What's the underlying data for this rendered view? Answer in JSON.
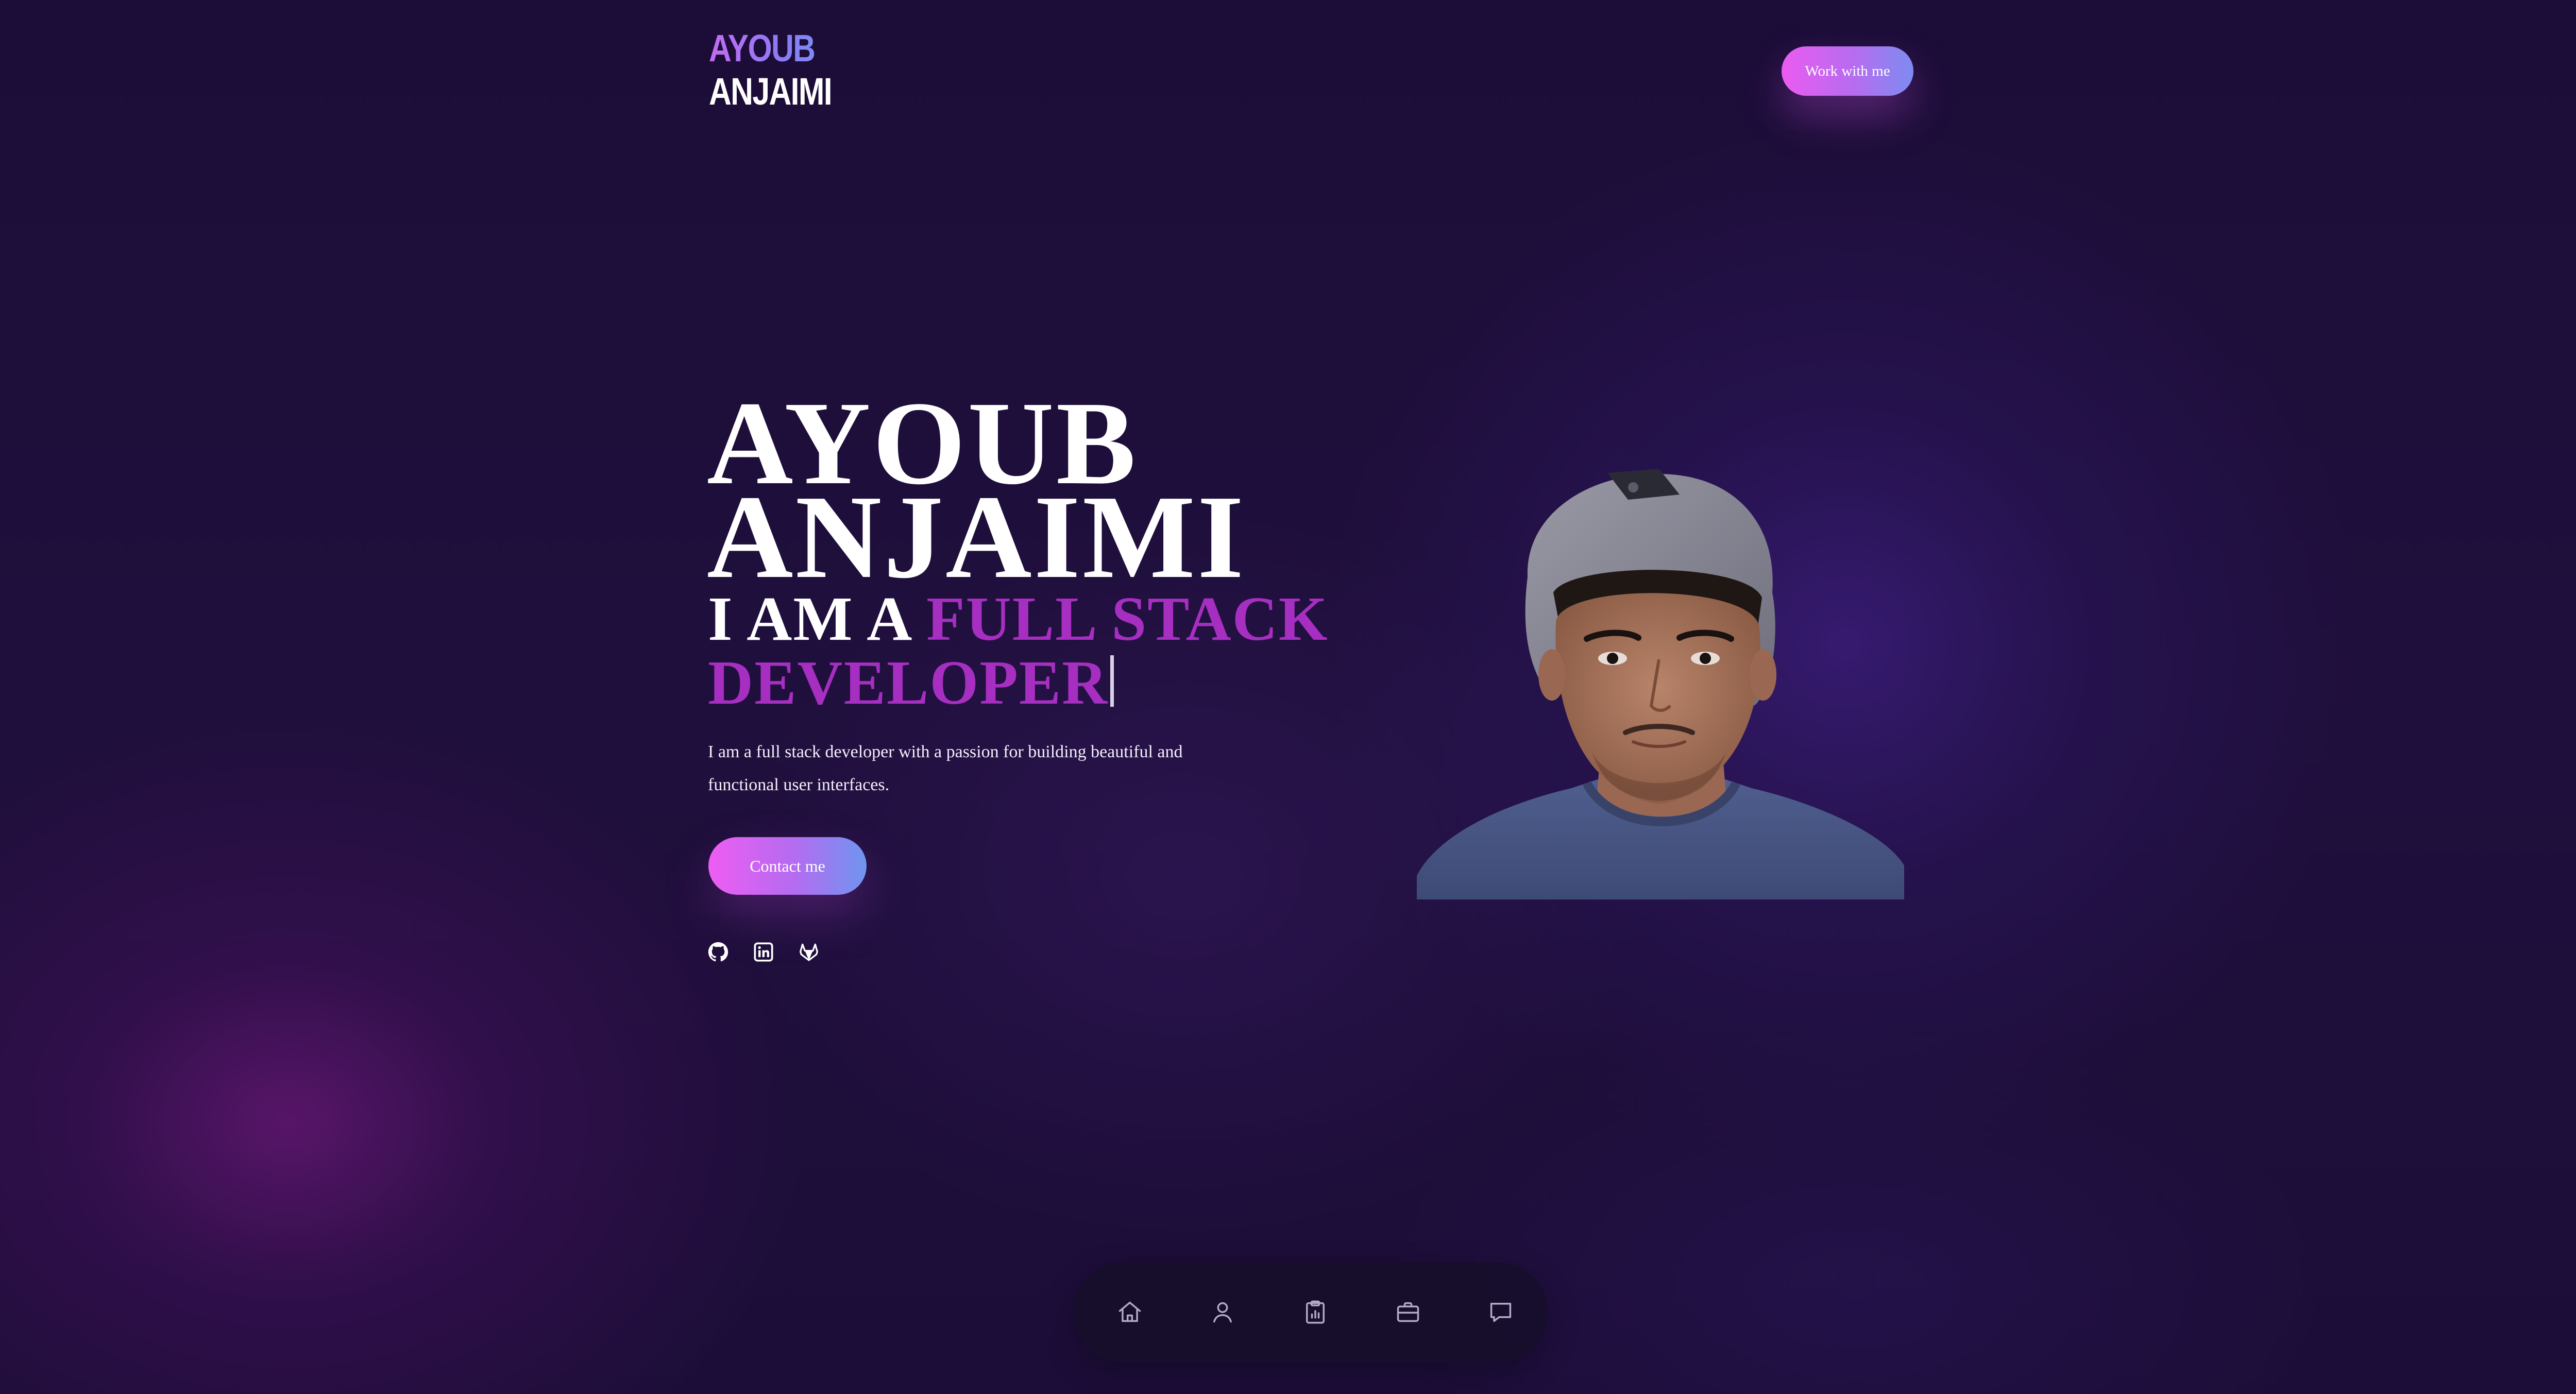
{
  "header": {
    "logo_line1": "AYOUB",
    "logo_line2": "ANJAIMI",
    "cta_label": "Work with me"
  },
  "hero": {
    "name_line1": "AYOUB",
    "name_line2": "ANJAIMI",
    "role_prefix": "I AM A ",
    "role_highlight": "FULL STACK DEVELOPER",
    "intro": "I am a full stack developer with a passion for building beautiful and functional user interfaces.",
    "contact_label": "Contact me",
    "socials": [
      "github-icon",
      "linkedin-icon",
      "gitlab-icon"
    ]
  },
  "dock": {
    "items": [
      "home-icon",
      "user-icon",
      "clipboard-chart-icon",
      "briefcase-icon",
      "chat-icon"
    ]
  },
  "colors": {
    "background": "#1b0d36",
    "accent_purple": "#a62ec0",
    "gradient_pink": "#ea5cf0",
    "gradient_blue": "#7d8cf0"
  }
}
